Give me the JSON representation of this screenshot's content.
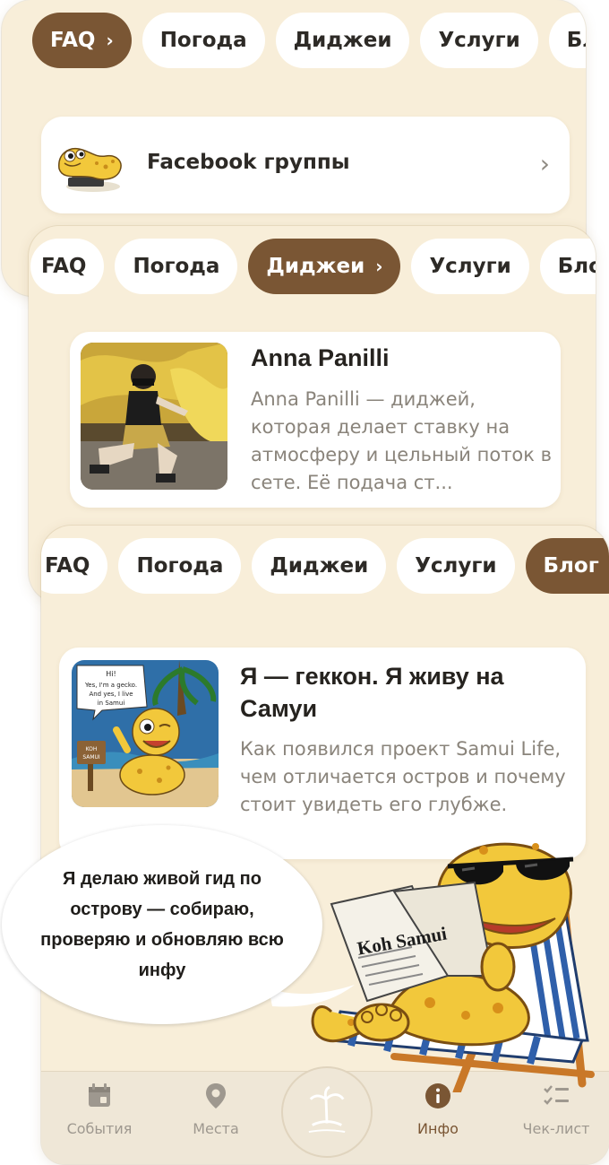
{
  "tab_labels": [
    "FAQ",
    "Погода",
    "Диджеи",
    "Услуги",
    "Блог"
  ],
  "chevron": "›",
  "screen_faq": {
    "active_tab": "FAQ",
    "facebook_row": {
      "label": "Facebook группы",
      "icon": "gecko-laptop-icon"
    }
  },
  "screen_djs": {
    "active_tab": "Диджеи",
    "article": {
      "title": "Anna Panilli",
      "body": "Anna Panilli — диджей, которая делает ставку на атмосферу и цельный поток в сете. Её подача ст..."
    }
  },
  "screen_blog": {
    "active_tab": "Блог",
    "article": {
      "title": "Я — геккон. Я живу на Самуи",
      "body": "Как появился проект Samui Life, чем отличается остров и почему стоит увидеть его глубже.",
      "thumb_speech": "Hi! Yes, I'm a gecko. And yes, I live in Samui",
      "thumb_sign": "KOH SAMUI"
    }
  },
  "speech_bubble": {
    "text": "Я делаю живой гид по острову — собираю, проверяю и обновляю всю инфу"
  },
  "mascot": {
    "newspaper_text": "Koh Samui"
  },
  "bottom_nav": {
    "items": [
      {
        "label": "События",
        "icon": "calendar-icon"
      },
      {
        "label": "Места",
        "icon": "map-pin-icon"
      },
      {
        "label": "Инфо",
        "icon": "info-icon",
        "active": true
      },
      {
        "label": "Чек-лист",
        "icon": "checklist-icon"
      }
    ]
  },
  "colors": {
    "background": "#f8eed9",
    "accent": "#7a5634",
    "pill_bg": "#ffffff",
    "muted_text": "#8a847b"
  }
}
